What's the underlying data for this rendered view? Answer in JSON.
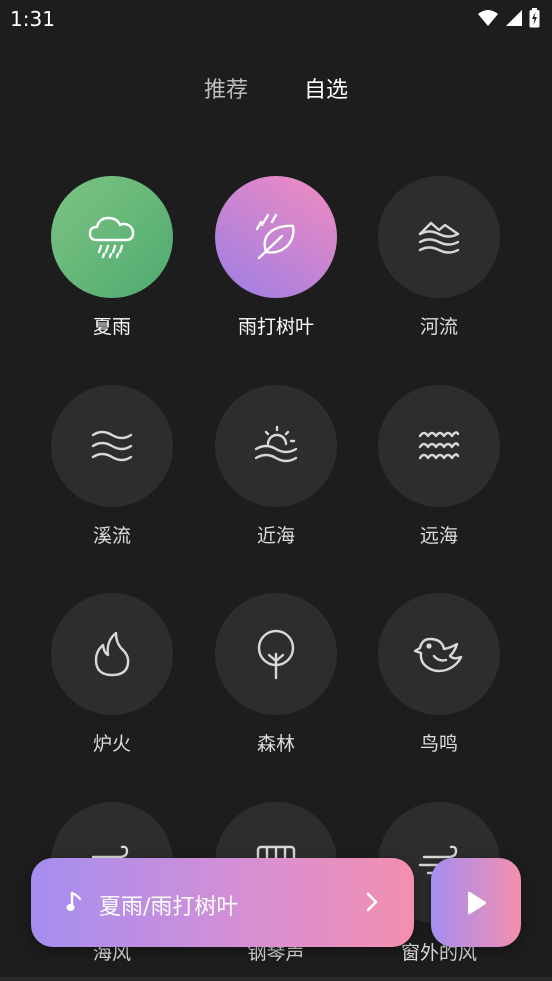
{
  "status": {
    "time": "1:31"
  },
  "tabs": [
    {
      "label": "推荐"
    },
    {
      "label": "自选"
    }
  ],
  "sounds": [
    {
      "label": "夏雨",
      "icon": "rain-cloud-icon",
      "active": true
    },
    {
      "label": "雨打树叶",
      "icon": "leaf-rain-icon",
      "active": true
    },
    {
      "label": "河流",
      "icon": "river-icon",
      "active": false
    },
    {
      "label": "溪流",
      "icon": "stream-icon",
      "active": false
    },
    {
      "label": "近海",
      "icon": "sunrise-sea-icon",
      "active": false
    },
    {
      "label": "远海",
      "icon": "ocean-waves-icon",
      "active": false
    },
    {
      "label": "炉火",
      "icon": "fire-icon",
      "active": false
    },
    {
      "label": "森林",
      "icon": "tree-icon",
      "active": false
    },
    {
      "label": "鸟鸣",
      "icon": "bird-icon",
      "active": false
    },
    {
      "label": "海风",
      "icon": "sea-wind-icon",
      "active": false
    },
    {
      "label": "钢琴声",
      "icon": "piano-icon",
      "active": false
    },
    {
      "label": "窗外的风",
      "icon": "window-wind-icon",
      "active": false
    }
  ],
  "player": {
    "title": "夏雨/雨打树叶"
  },
  "colors": {
    "background": "#1d1d1d",
    "circle_inactive": "#2d2d2d",
    "accent_green": "#5fb578",
    "accent_purple": "#a48ef0",
    "accent_pink": "#f48faf"
  }
}
